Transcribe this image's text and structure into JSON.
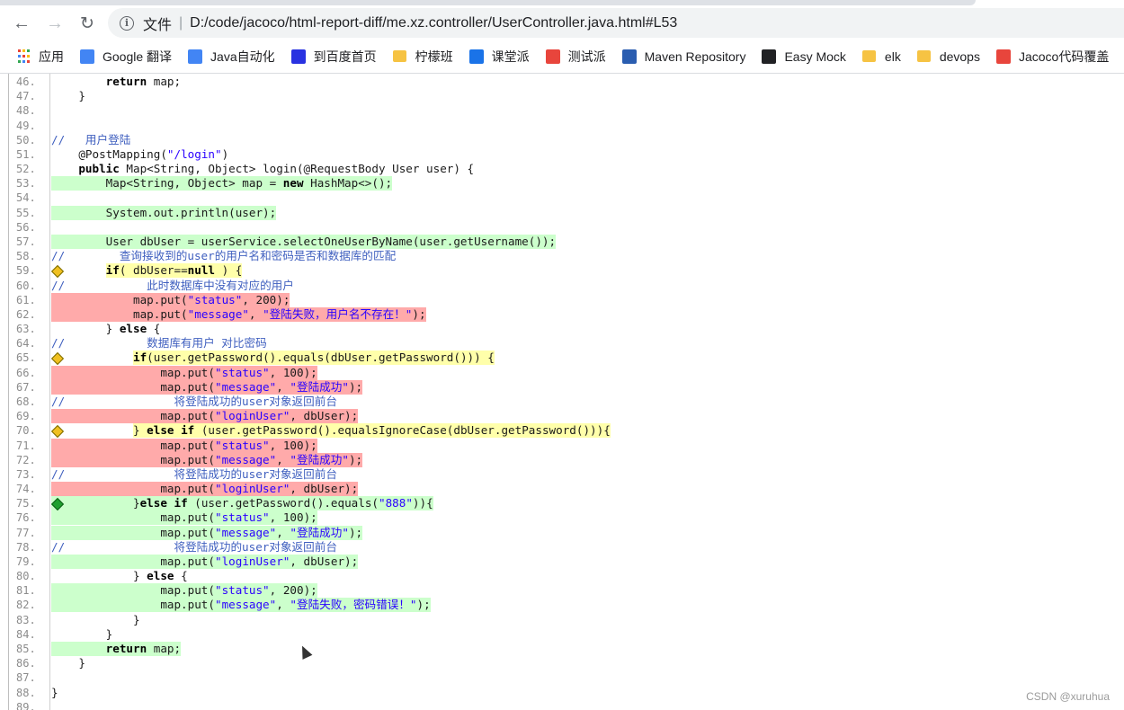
{
  "browser": {
    "omnibox_label": "文件",
    "omnibox_separator": "|",
    "url": "D:/code/jacoco/html-report-diff/me.xz.controller/UserController.java.html#L53"
  },
  "bookmarks": [
    {
      "label": "应用",
      "icon": "apps-grid-icon",
      "color": "#ea4335"
    },
    {
      "label": "Google 翻译",
      "icon": "google-translate-icon",
      "color": "#4285f4"
    },
    {
      "label": "Java自动化",
      "icon": "doc-icon",
      "color": "#4285f4"
    },
    {
      "label": "到百度首页",
      "icon": "baidu-paw-icon",
      "color": "#2932e1"
    },
    {
      "label": "柠檬班",
      "icon": "folder-icon",
      "color": "#f6c343"
    },
    {
      "label": "课堂派",
      "icon": "ketangpai-icon",
      "color": "#1a73e8"
    },
    {
      "label": "测试派",
      "icon": "ceshipai-icon",
      "color": "#e8453c"
    },
    {
      "label": "Maven Repository",
      "icon": "maven-icon",
      "color": "#2a5db0"
    },
    {
      "label": "Easy Mock",
      "icon": "easymock-icon",
      "color": "#202124"
    },
    {
      "label": "elk",
      "icon": "folder-icon",
      "color": "#f6c343"
    },
    {
      "label": "devops",
      "icon": "folder-icon",
      "color": "#f6c343"
    },
    {
      "label": "Jacoco代码覆盖",
      "icon": "jacoco-icon",
      "color": "#e8453c"
    }
  ],
  "code_lines": [
    {
      "num": "46.",
      "cov": "none",
      "code": "        return map;",
      "branch": ""
    },
    {
      "num": "47.",
      "cov": "none",
      "code": "    }",
      "branch": ""
    },
    {
      "num": "48.",
      "cov": "none",
      "code": "",
      "branch": ""
    },
    {
      "num": "49.",
      "cov": "none",
      "code": "",
      "branch": ""
    },
    {
      "num": "50.",
      "cov": "none",
      "code": "//   用户登陆",
      "branch": ""
    },
    {
      "num": "51.",
      "cov": "none",
      "code": "    @PostMapping(\"/login\")",
      "branch": ""
    },
    {
      "num": "52.",
      "cov": "none",
      "code": "    public Map<String, Object> login(@RequestBody User user) {",
      "branch": ""
    },
    {
      "num": "53.",
      "cov": "fc",
      "code": "        Map<String, Object> map = new HashMap<>();",
      "branch": ""
    },
    {
      "num": "54.",
      "cov": "none",
      "code": "",
      "branch": ""
    },
    {
      "num": "55.",
      "cov": "fc",
      "code": "        System.out.println(user);",
      "branch": ""
    },
    {
      "num": "56.",
      "cov": "none",
      "code": "",
      "branch": ""
    },
    {
      "num": "57.",
      "cov": "fc",
      "code": "        User dbUser = userService.selectOneUserByName(user.getUsername());",
      "branch": ""
    },
    {
      "num": "58.",
      "cov": "none",
      "code": "//        查询接收到的user的用户名和密码是否和数据库的匹配",
      "branch": ""
    },
    {
      "num": "59.",
      "cov": "pc",
      "code": "        if( dbUser==null ) {",
      "branch": "yellow"
    },
    {
      "num": "60.",
      "cov": "none",
      "code": "//            此时数据库中没有对应的用户",
      "branch": ""
    },
    {
      "num": "61.",
      "cov": "nc",
      "code": "            map.put(\"status\", 200);",
      "branch": ""
    },
    {
      "num": "62.",
      "cov": "nc",
      "code": "            map.put(\"message\", \"登陆失败，用户名不存在！\");",
      "branch": ""
    },
    {
      "num": "63.",
      "cov": "none",
      "code": "        } else {",
      "branch": ""
    },
    {
      "num": "64.",
      "cov": "none",
      "code": "//            数据库有用户 对比密码",
      "branch": ""
    },
    {
      "num": "65.",
      "cov": "pc",
      "code": "            if(user.getPassword().equals(dbUser.getPassword())) {",
      "branch": "yellow"
    },
    {
      "num": "66.",
      "cov": "nc",
      "code": "                map.put(\"status\", 100);",
      "branch": ""
    },
    {
      "num": "67.",
      "cov": "nc",
      "code": "                map.put(\"message\", \"登陆成功\");",
      "branch": ""
    },
    {
      "num": "68.",
      "cov": "none",
      "code": "//                将登陆成功的user对象返回前台",
      "branch": ""
    },
    {
      "num": "69.",
      "cov": "nc",
      "code": "                map.put(\"loginUser\", dbUser);",
      "branch": ""
    },
    {
      "num": "70.",
      "cov": "pc",
      "code": "            } else if (user.getPassword().equalsIgnoreCase(dbUser.getPassword())){",
      "branch": "yellow"
    },
    {
      "num": "71.",
      "cov": "nc",
      "code": "                map.put(\"status\", 100);",
      "branch": ""
    },
    {
      "num": "72.",
      "cov": "nc",
      "code": "                map.put(\"message\", \"登陆成功\");",
      "branch": ""
    },
    {
      "num": "73.",
      "cov": "none",
      "code": "//                将登陆成功的user对象返回前台",
      "branch": ""
    },
    {
      "num": "74.",
      "cov": "nc",
      "code": "                map.put(\"loginUser\", dbUser);",
      "branch": ""
    },
    {
      "num": "75.",
      "cov": "fc",
      "code": "            }else if (user.getPassword().equals(\"888\")){",
      "branch": "green"
    },
    {
      "num": "76.",
      "cov": "fc",
      "code": "                map.put(\"status\", 100);",
      "branch": ""
    },
    {
      "num": "77.",
      "cov": "fc",
      "code": "                map.put(\"message\", \"登陆成功\");",
      "branch": ""
    },
    {
      "num": "78.",
      "cov": "none",
      "code": "//                将登陆成功的user对象返回前台",
      "branch": ""
    },
    {
      "num": "79.",
      "cov": "fc",
      "code": "                map.put(\"loginUser\", dbUser);",
      "branch": ""
    },
    {
      "num": "80.",
      "cov": "none",
      "code": "            } else {",
      "branch": ""
    },
    {
      "num": "81.",
      "cov": "fc",
      "code": "                map.put(\"status\", 200);",
      "branch": ""
    },
    {
      "num": "82.",
      "cov": "fc",
      "code": "                map.put(\"message\", \"登陆失败，密码错误！\");",
      "branch": ""
    },
    {
      "num": "83.",
      "cov": "none",
      "code": "            }",
      "branch": ""
    },
    {
      "num": "84.",
      "cov": "none",
      "code": "        }",
      "branch": ""
    },
    {
      "num": "85.",
      "cov": "fc",
      "code": "        return map;",
      "branch": ""
    },
    {
      "num": "86.",
      "cov": "none",
      "code": "    }",
      "branch": ""
    },
    {
      "num": "87.",
      "cov": "none",
      "code": "",
      "branch": ""
    },
    {
      "num": "88.",
      "cov": "none",
      "code": "}",
      "branch": ""
    },
    {
      "num": "89.",
      "cov": "none",
      "code": "",
      "branch": ""
    }
  ],
  "coverage_colors": {
    "fc": "#ccffcc",
    "nc": "#ffaaaa",
    "pc": "#ffffaa"
  },
  "watermark": "CSDN @xuruhua"
}
